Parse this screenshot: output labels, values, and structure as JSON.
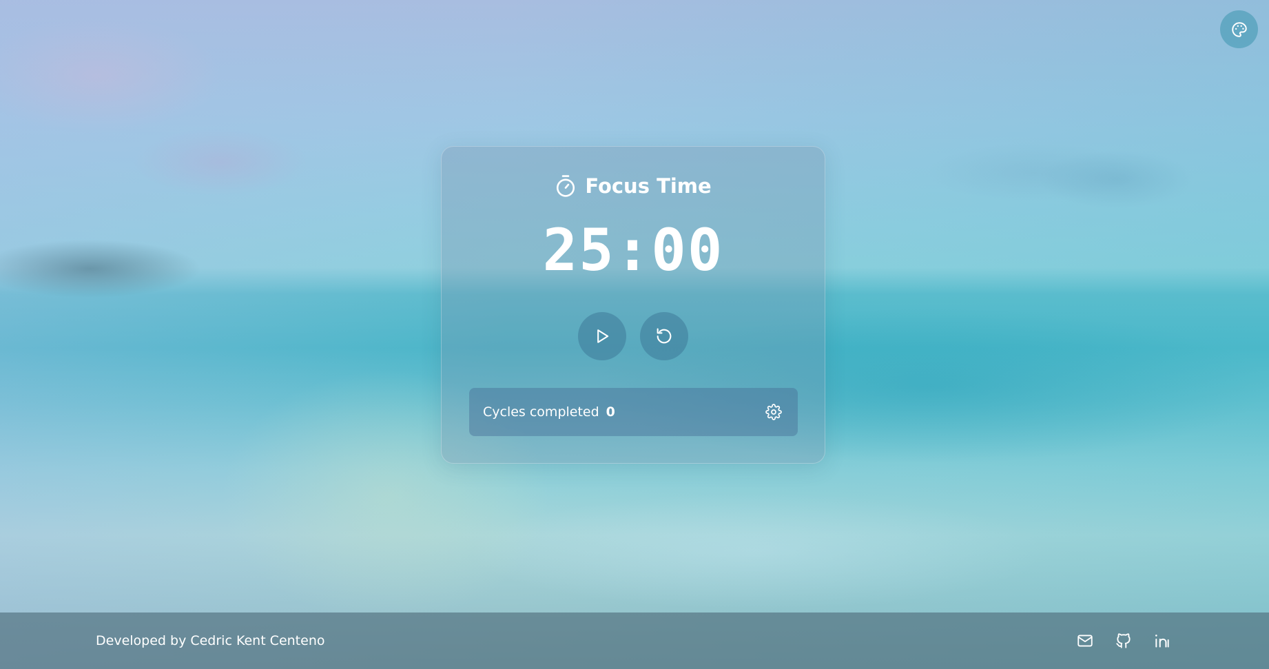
{
  "theme": {
    "button_icon": "palette-icon",
    "text_color": "#ffffff"
  },
  "timer_card": {
    "title_icon": "stopwatch-icon",
    "title": "Focus Time",
    "time_display": "25:00",
    "controls": {
      "start_icon": "play-icon",
      "reset_icon": "reset-icon"
    },
    "cycles": {
      "label": "Cycles completed",
      "count": "0",
      "settings_icon": "gear-icon"
    }
  },
  "footer": {
    "credit": "Developed by Cedric Kent Centeno",
    "links": [
      {
        "icon": "mail-icon"
      },
      {
        "icon": "github-icon"
      },
      {
        "icon": "linkedin-icon"
      }
    ]
  }
}
